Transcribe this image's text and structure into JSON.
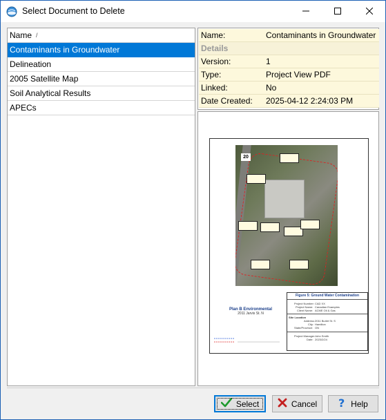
{
  "window": {
    "title": "Select Document to Delete",
    "icon": "globe-icon"
  },
  "titlebar_buttons": {
    "minimize": "minimize-icon",
    "maximize": "maximize-icon",
    "close": "close-icon"
  },
  "list": {
    "header": "Name",
    "sort_glyph": "/",
    "items": [
      {
        "label": "Contaminants in Groundwater",
        "selected": true
      },
      {
        "label": "Delineation",
        "selected": false
      },
      {
        "label": "2005 Satellite Map",
        "selected": false
      },
      {
        "label": "Soil Analytical Results",
        "selected": false
      },
      {
        "label": "APECs",
        "selected": false
      }
    ]
  },
  "properties": {
    "name_key": "Name:",
    "name_value": "Contaminants in Groundwater",
    "details_header": "Details",
    "version_key": "Version:",
    "version_value": "1",
    "type_key": "Type:",
    "type_value": "Project View PDF",
    "linked_key": "Linked:",
    "linked_value": "No",
    "date_key": "Date Created:",
    "date_value": "2025-04-12 2:24:03 PM"
  },
  "preview": {
    "map_number": "20",
    "figure_title": "Figure 5: Ground Water Contamination",
    "company_name": "Plan B Environmental",
    "company_address": "2011 Jarvis St. N",
    "project_number_label": "Project Number:",
    "project_number": "CAD XX",
    "project_name_label": "Project Name:",
    "project_name": "Canadian Examples",
    "client_name_label": "Client Name:",
    "client_name": "ACME Oil & Gas",
    "site_location_label": "Site Location",
    "address_label": "Address:",
    "address": "2011 Burlet St. S",
    "city_label": "City:",
    "city": "Hamilton",
    "province_label": "State/Province:",
    "province": "ON",
    "manager_label": "Project Manager:",
    "manager": "John Smith",
    "date_label": "Date:",
    "date": "2023/2/24"
  },
  "buttons": {
    "select": "Select",
    "cancel": "Cancel",
    "help": "Help"
  },
  "colors": {
    "selection": "#0078d7",
    "property_bg": "#fdf8dc",
    "accent_border": "#1a5fb4"
  }
}
